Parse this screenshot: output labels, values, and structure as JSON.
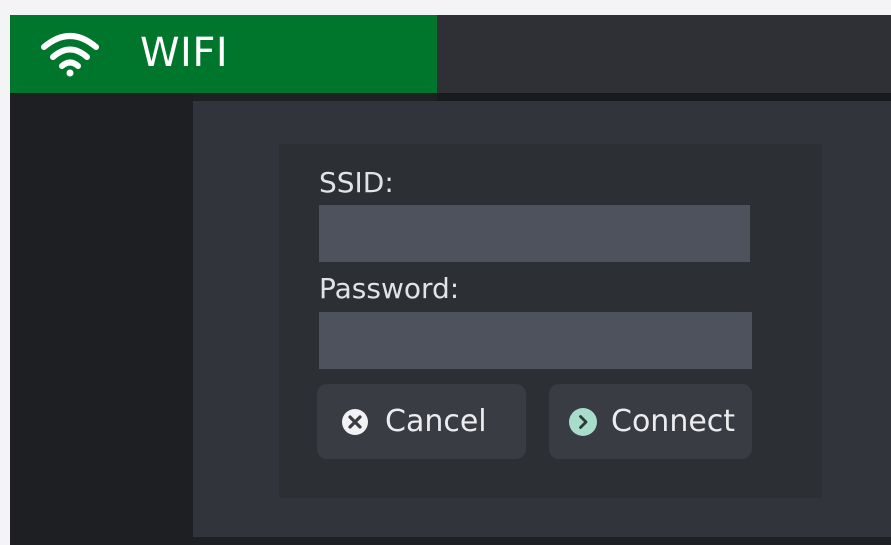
{
  "header": {
    "title": "WIFI",
    "icon": "wifi-icon",
    "accent_color": "#00762D"
  },
  "form": {
    "ssid": {
      "label": "SSID:",
      "value": "",
      "placeholder": ""
    },
    "password": {
      "label": "Password:",
      "value": "",
      "placeholder": ""
    }
  },
  "buttons": {
    "cancel": {
      "label": "Cancel",
      "icon": "close-circle-icon"
    },
    "connect": {
      "label": "Connect",
      "icon": "chevron-right-circle-icon",
      "icon_color": "#A8DCCB"
    }
  }
}
